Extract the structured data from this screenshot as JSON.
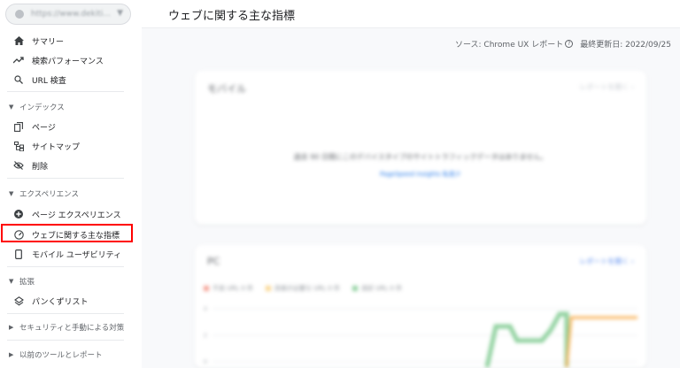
{
  "sidebar": {
    "property_url": "https://www.dekiti...",
    "nav": [
      {
        "label": "サマリー"
      },
      {
        "label": "検索パフォーマンス"
      },
      {
        "label": "URL 検査"
      }
    ],
    "sections": [
      {
        "header": "インデックス",
        "items": [
          {
            "label": "ページ"
          },
          {
            "label": "サイトマップ"
          },
          {
            "label": "削除"
          }
        ]
      },
      {
        "header": "エクスペリエンス",
        "items": [
          {
            "label": "ページ エクスペリエンス"
          },
          {
            "label": "ウェブに関する主な指標"
          },
          {
            "label": "モバイル ユーザビリティ"
          }
        ]
      },
      {
        "header": "拡張",
        "items": [
          {
            "label": "パンくずリスト"
          }
        ]
      }
    ],
    "collapsed": [
      {
        "label": "セキュリティと手動による対策"
      },
      {
        "label": "以前のツールとレポート"
      }
    ]
  },
  "header": {
    "title": "ウェブに関する主な指標"
  },
  "meta": {
    "source": "ソース: Chrome UX レポート",
    "updated": "最終更新日: 2022/09/25"
  },
  "mobile_card": {
    "title": "モバイル",
    "link": "レポートを開く",
    "message": "過去 90 日間にこのデバイスタイプのサイトトラフィックデータはありません。",
    "sub_link": "PageSpeed Insights 私見テ"
  },
  "pc_card": {
    "title": "PC",
    "link": "レポートを開く",
    "legend": [
      {
        "label": "不良 URL 0 件",
        "color": "#f4a093"
      },
      {
        "label": "改善が必要な URL 0 件",
        "color": "#f9d58e"
      },
      {
        "label": "良好 URL 0 件",
        "color": "#8fd19e"
      }
    ]
  },
  "colors": {
    "highlight": "#ff0000",
    "good": "#8fd19e",
    "needs_improvement": "#f9b35a",
    "link": "#1a73e8"
  }
}
